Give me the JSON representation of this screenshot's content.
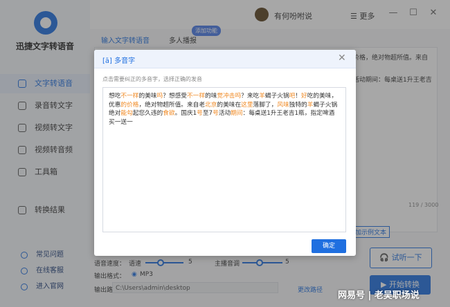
{
  "app": {
    "name": "迅捷文字转语音",
    "brand_color": "#1f6fe0"
  },
  "sidebar": {
    "items": [
      {
        "label": "文字转语音",
        "icon": "text-icon",
        "active": true
      },
      {
        "label": "录音转文字",
        "icon": "record-icon"
      },
      {
        "label": "视频转文字",
        "icon": "video-icon"
      },
      {
        "label": "视频转音频",
        "icon": "video-audio-icon"
      },
      {
        "label": "工具箱",
        "icon": "toolbox-icon"
      },
      {
        "label": "转换结果",
        "icon": "result-icon"
      }
    ],
    "bottom": [
      {
        "label": "常见问题",
        "icon": "help-icon"
      },
      {
        "label": "在线客服",
        "icon": "service-icon"
      },
      {
        "label": "进入官网",
        "icon": "website-icon"
      }
    ]
  },
  "topbar": {
    "username": "有何吩咐说",
    "more_label": "☰ 更多",
    "minimize": "—",
    "maximize": "☐",
    "close": "✕"
  },
  "main": {
    "tabs": [
      "输入文字转语音",
      "多人播报"
    ],
    "tab_badge": "添加功能",
    "bg_text_lines": [
      "价格，绝对物超所值。来自",
      "活动期间：每桌送1升王老吉"
    ],
    "counter": "119 / 3000",
    "bg_link": "加示例文本",
    "speed_label": "语音速度：",
    "speed_prefix": "语速",
    "speed_value": "5",
    "volume_label": "主播音调",
    "volume_value": "5",
    "format_label": "输出格式：",
    "format_value": "MP3",
    "path_label": "输出路径：",
    "path_value": "C:\\Users\\admin\\desktop",
    "change_path": "更改路径",
    "try_button": "试听一下",
    "start_button": "开始转换"
  },
  "dialog": {
    "title": "[ā]  多音字",
    "close": "✕",
    "hint": "点击需要纠正的多音字，选择正确的发音",
    "segments": [
      {
        "t": "想吃"
      },
      {
        "t": "不一样",
        "p": true
      },
      {
        "t": "的美味"
      },
      {
        "t": "吗",
        "p": true
      },
      {
        "t": "？想感受"
      },
      {
        "t": "不一样",
        "p": true
      },
      {
        "t": "的味"
      },
      {
        "t": "觉冲击",
        "p": true
      },
      {
        "t": "吗",
        "p": true
      },
      {
        "t": "？来吃"
      },
      {
        "t": "羊",
        "p": true
      },
      {
        "t": "蝎子火锅"
      },
      {
        "t": "吧",
        "p": true
      },
      {
        "t": "！"
      },
      {
        "t": "好",
        "p": true
      },
      {
        "t": "吃的美味，优惠"
      },
      {
        "t": "的价格",
        "p": true
      },
      {
        "t": "，绝对物超所值。来自老"
      },
      {
        "t": "北京",
        "p": true
      },
      {
        "t": "的美味在"
      },
      {
        "t": "这里",
        "p": true
      },
      {
        "t": "落脚了，"
      },
      {
        "t": "风味",
        "p": true
      },
      {
        "t": "独特的"
      },
      {
        "t": "羊",
        "p": true
      },
      {
        "t": "蝎子火锅绝对"
      },
      {
        "t": "能勾",
        "p": true
      },
      {
        "t": "起您久违的"
      },
      {
        "t": "食欲",
        "p": true
      },
      {
        "t": "。国庆1"
      },
      {
        "t": "号",
        "p": true
      },
      {
        "t": "至7"
      },
      {
        "t": "号",
        "p": true
      },
      {
        "t": "活动"
      },
      {
        "t": "期间",
        "p": true
      },
      {
        "t": "：每桌送1升王老吉1瓶，指定啤酒买一送一"
      }
    ],
    "confirm": "确定"
  },
  "watermark": "网易号 | 老吴职场说"
}
